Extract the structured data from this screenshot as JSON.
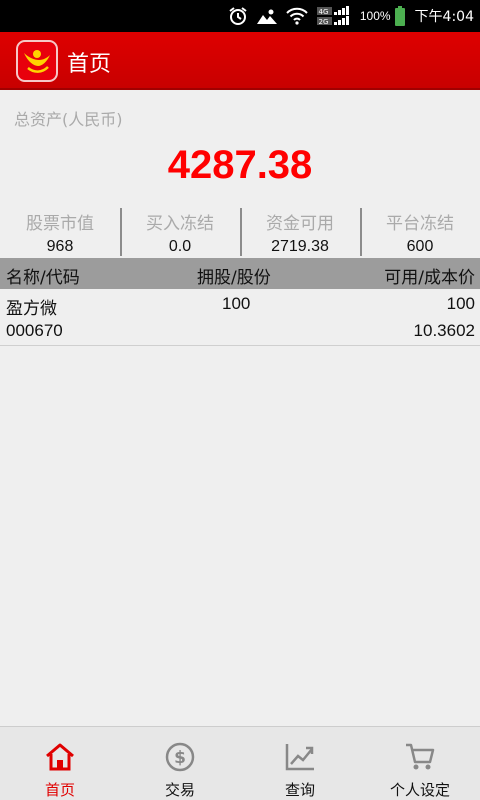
{
  "status_bar": {
    "network_top": "4G",
    "network_bottom": "2G",
    "battery": "100%",
    "time": "下午4:04",
    "icons": [
      "alarm-icon",
      "photo-notification-icon",
      "wifi-icon",
      "signal-icon",
      "battery-icon"
    ]
  },
  "header": {
    "title": "首页",
    "logo": "app-logo-icon",
    "brand_color": "#d40000"
  },
  "assets": {
    "label": "总资产(人民币)",
    "total": "4287.38",
    "total_color": "#ff0000",
    "stats": [
      {
        "label": "股票市值",
        "value": "968"
      },
      {
        "label": "买入冻结",
        "value": "0.0"
      },
      {
        "label": "资金可用",
        "value": "2719.38"
      },
      {
        "label": "平台冻结",
        "value": "600"
      }
    ]
  },
  "holdings": {
    "columns": {
      "name": "名称/代码",
      "hold": "拥股/股份",
      "avail": "可用/成本价"
    },
    "rows": [
      {
        "name": "盈方微",
        "code": "000670",
        "hold": "100",
        "avail": "100",
        "cost": "10.3602"
      }
    ]
  },
  "nav": {
    "items": [
      {
        "label": "首页",
        "icon": "home-icon",
        "active": true
      },
      {
        "label": "交易",
        "icon": "dollar-icon",
        "active": false
      },
      {
        "label": "查询",
        "icon": "chart-icon",
        "active": false
      },
      {
        "label": "个人设定",
        "icon": "cart-icon",
        "active": false
      }
    ],
    "active_color": "#e00000"
  }
}
